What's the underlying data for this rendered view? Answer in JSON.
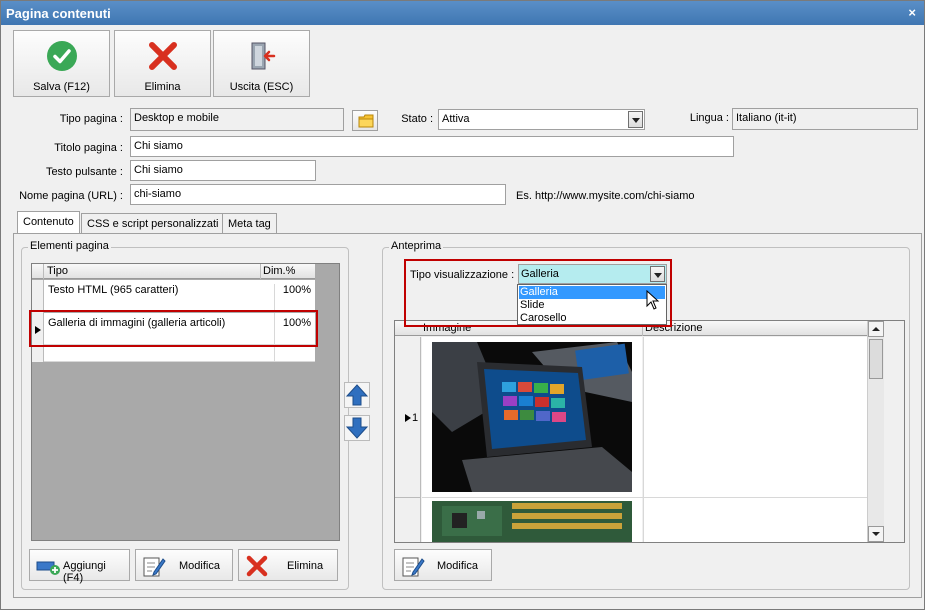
{
  "window": {
    "title": "Pagina contenuti",
    "close_glyph": "×"
  },
  "toolbar": {
    "save_label": "Salva (F12)",
    "delete_label": "Elimina",
    "exit_label": "Uscita (ESC)"
  },
  "form": {
    "tipo_pagina_label": "Tipo pagina :",
    "tipo_pagina_value": "Desktop e mobile",
    "stato_label": "Stato :",
    "stato_value": "Attiva",
    "lingua_label": "Lingua :",
    "lingua_value": "Italiano (it-it)",
    "titolo_label": "Titolo pagina :",
    "titolo_value": "Chi siamo",
    "testo_pulsante_label": "Testo pulsante :",
    "testo_pulsante_value": "Chi siamo",
    "nome_pagina_label": "Nome pagina (URL) :",
    "nome_pagina_value": "chi-siamo",
    "url_hint": "Es. http://www.mysite.com/chi-siamo"
  },
  "tabs": [
    "Contenuto",
    "CSS e script personalizzati",
    "Meta tag"
  ],
  "elementi": {
    "group_title": "Elementi pagina",
    "col_tipo": "Tipo",
    "col_dim": "Dim.%",
    "rows": [
      {
        "tipo": "Testo HTML (965 caratteri)",
        "dim": "100%"
      },
      {
        "tipo": "Galleria di immagini (galleria articoli)",
        "dim": "100%"
      }
    ],
    "add_label": "Aggiungi (F4)",
    "edit_label": "Modifica",
    "delete_label": "Elimina"
  },
  "anteprima": {
    "group_title": "Anteprima",
    "tipo_vis_label": "Tipo visualizzazione :",
    "tipo_vis_value": "Galleria",
    "options": [
      "Galleria",
      "Slide",
      "Carosello"
    ],
    "col_immagine": "Immagine",
    "col_descrizione": "Descrizione",
    "row1_index": "1",
    "edit_label": "Modifica"
  },
  "colors": {
    "accent_red": "#c00000",
    "titlebar": "#3f76b2",
    "selection": "#3399ff"
  }
}
